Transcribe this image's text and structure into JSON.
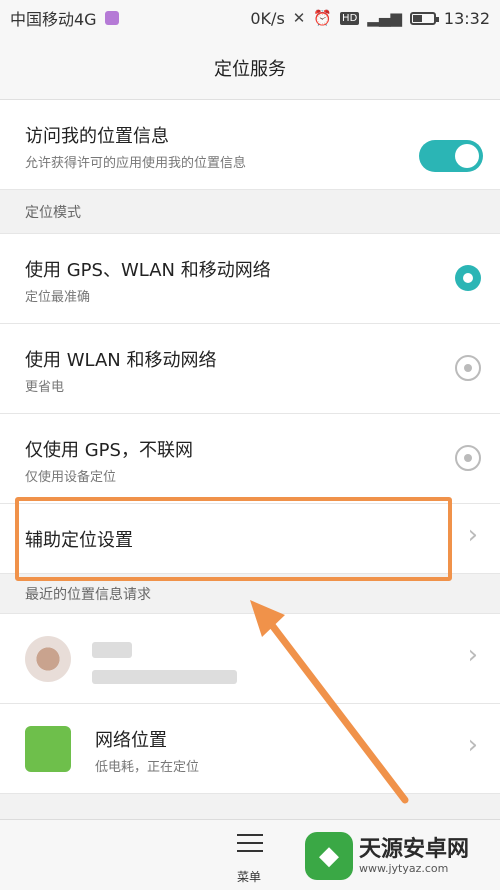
{
  "status_bar": {
    "carrier": "中国移动4G",
    "net_speed": "0K/s",
    "network_label": "4G",
    "time": "13:32",
    "battery_percent": 45,
    "icons": [
      "picture-icon",
      "mute-icon",
      "alarm-icon",
      "hd-icon",
      "signal-icon",
      "battery-icon"
    ]
  },
  "header": {
    "title": "定位服务"
  },
  "location_toggle": {
    "title": "访问我的位置信息",
    "subtitle": "允许获得许可的应用使用我的位置信息",
    "enabled": true
  },
  "mode_section": {
    "header": "定位模式",
    "options": [
      {
        "title": "使用 GPS、WLAN 和移动网络",
        "subtitle": "定位最准确",
        "selected": true
      },
      {
        "title": "使用 WLAN 和移动网络",
        "subtitle": "更省电",
        "selected": false
      },
      {
        "title": "仅使用 GPS，不联网",
        "subtitle": "仅使用设备定位",
        "selected": false
      }
    ]
  },
  "assist_setting": {
    "title": "辅助定位设置"
  },
  "recent_section": {
    "header": "最近的位置信息请求",
    "items": [
      {
        "title": "",
        "subtitle": ""
      },
      {
        "title": "网络位置",
        "subtitle": "低电耗，正在定位"
      }
    ]
  },
  "bottom_bar": {
    "menu_label": "菜单"
  },
  "watermark": {
    "text": "天源安卓网",
    "url": "www.jytyaz.com"
  },
  "colors": {
    "accent": "#2bb5b5",
    "highlight": "#f0924a"
  }
}
